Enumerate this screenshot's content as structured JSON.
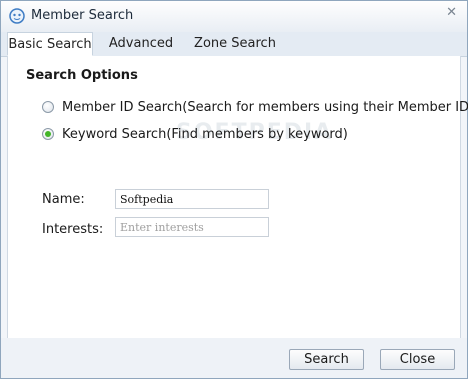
{
  "window": {
    "title": "Member Search",
    "close_glyph": "✕",
    "icon": "app-logo-icon"
  },
  "tabs": [
    {
      "label": "Basic Search",
      "active": true
    },
    {
      "label": "Advanced",
      "active": false
    },
    {
      "label": "Zone Search",
      "active": false
    }
  ],
  "search_options": {
    "title": "Search Options",
    "options": [
      {
        "label": "Member ID Search(Search for members using their Member ID)",
        "checked": false
      },
      {
        "label": "Keyword Search(Find members by keyword)",
        "checked": true
      }
    ]
  },
  "form": {
    "name_label": "Name:",
    "name_value": "Softpedia",
    "interests_label": "Interests:",
    "interests_placeholder": "Enter interests"
  },
  "watermark": "SOFTPEDIA",
  "buttons": {
    "search": "Search",
    "close": "Close"
  },
  "colors": {
    "radio_checked": "#43b529",
    "window_border": "#8fa6bd",
    "tabbar_bg": "#e4ebf3"
  }
}
